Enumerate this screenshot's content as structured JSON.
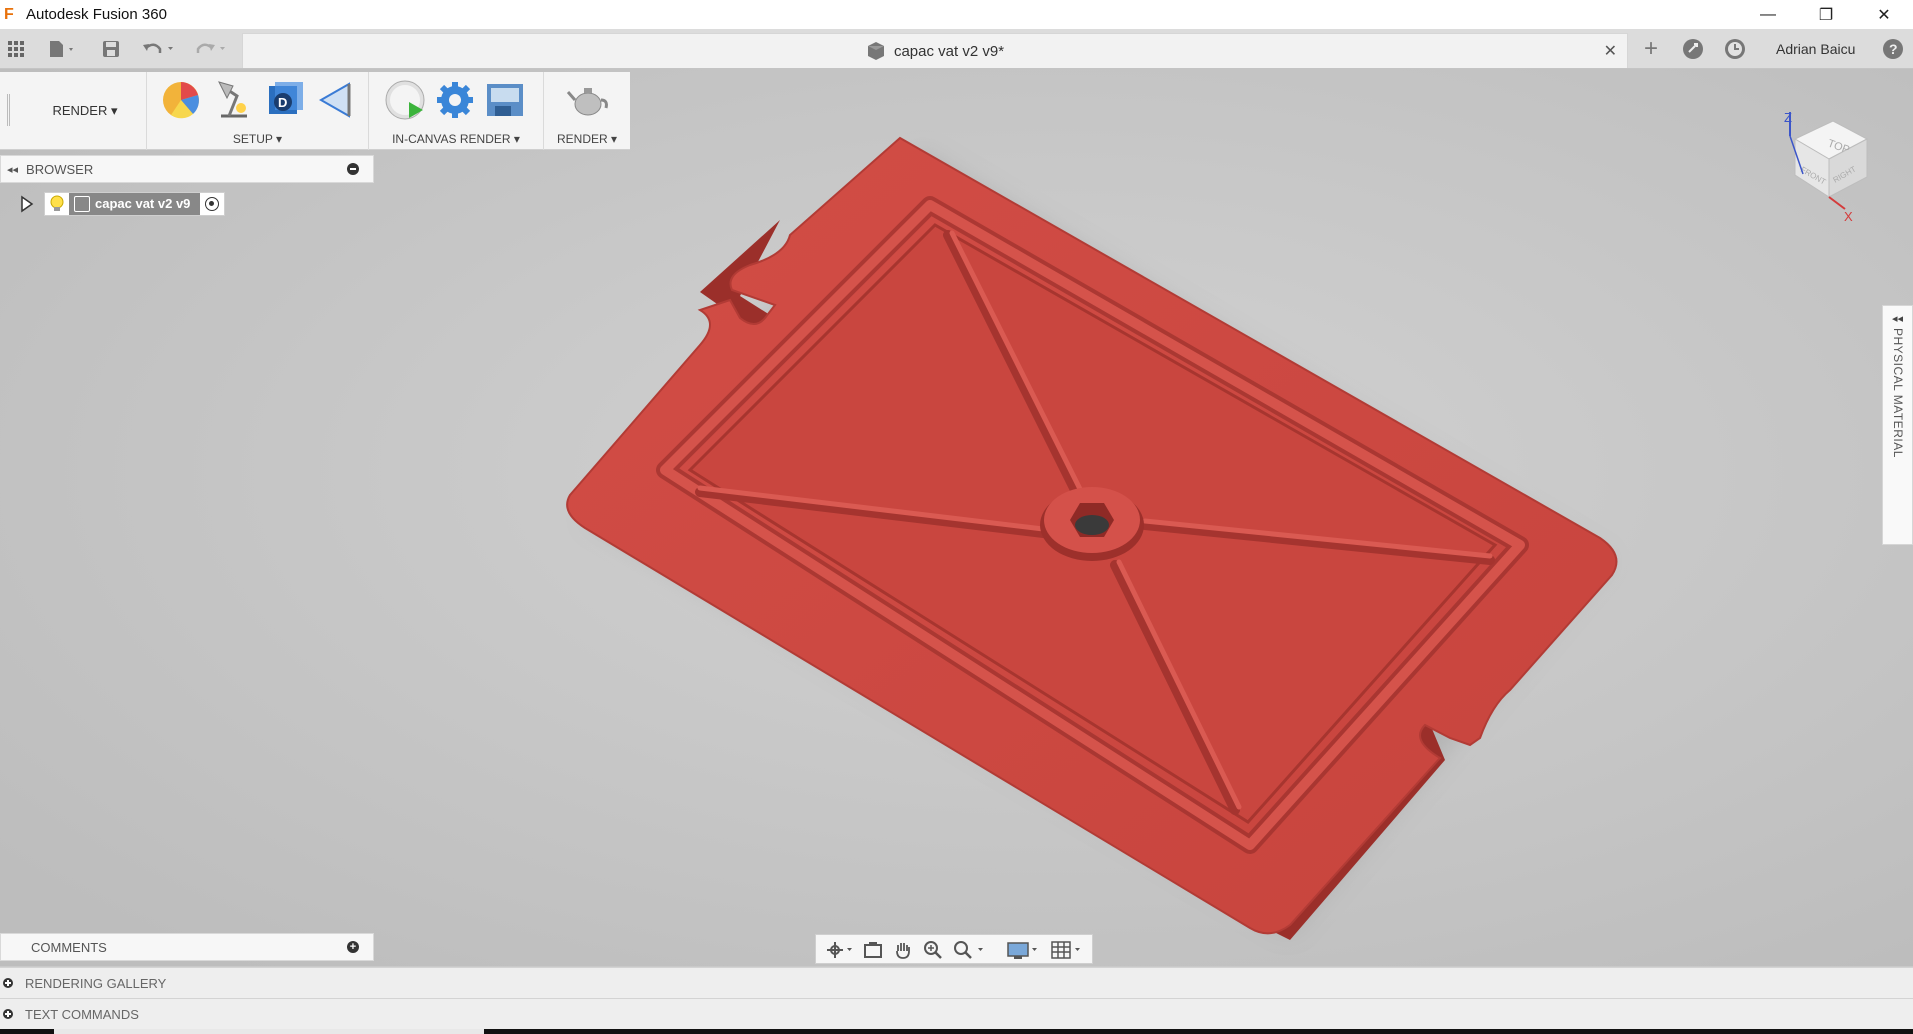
{
  "window": {
    "app_title": "Autodesk Fusion 360",
    "logo_letter": "F",
    "minimize": "—",
    "restore": "❐",
    "close": "✕"
  },
  "topbar": {
    "doc_title": "capac vat v2 v9*",
    "user_name": "Adrian Baicu",
    "new_tab": "+",
    "help": "?"
  },
  "ribbon": {
    "workspace": "RENDER ▾",
    "groups": [
      {
        "label": "SETUP ▾"
      },
      {
        "label": "IN-CANVAS RENDER ▾"
      },
      {
        "label": "RENDER ▾"
      }
    ]
  },
  "browser": {
    "collapse": "◂◂",
    "title": "BROWSER",
    "root_node": "capac vat v2 v9"
  },
  "side_panel": {
    "arrow": "◂◂",
    "title": "PHYSICAL MATERIAL"
  },
  "viewcube": {
    "top": "TOP",
    "front": "FRONT",
    "right": "RIGHT",
    "axis_z": "Z",
    "axis_x": "X"
  },
  "comments": {
    "title": "COMMENTS"
  },
  "bottom_panels": [
    {
      "title": "RENDERING GALLERY"
    },
    {
      "title": "TEXT COMMANDS"
    }
  ],
  "colors": {
    "part_red": "#cc4a43",
    "part_shadow": "#9b2f2a",
    "canvas_bg": "#c9c9c9",
    "accent_orange": "#e8720c"
  }
}
